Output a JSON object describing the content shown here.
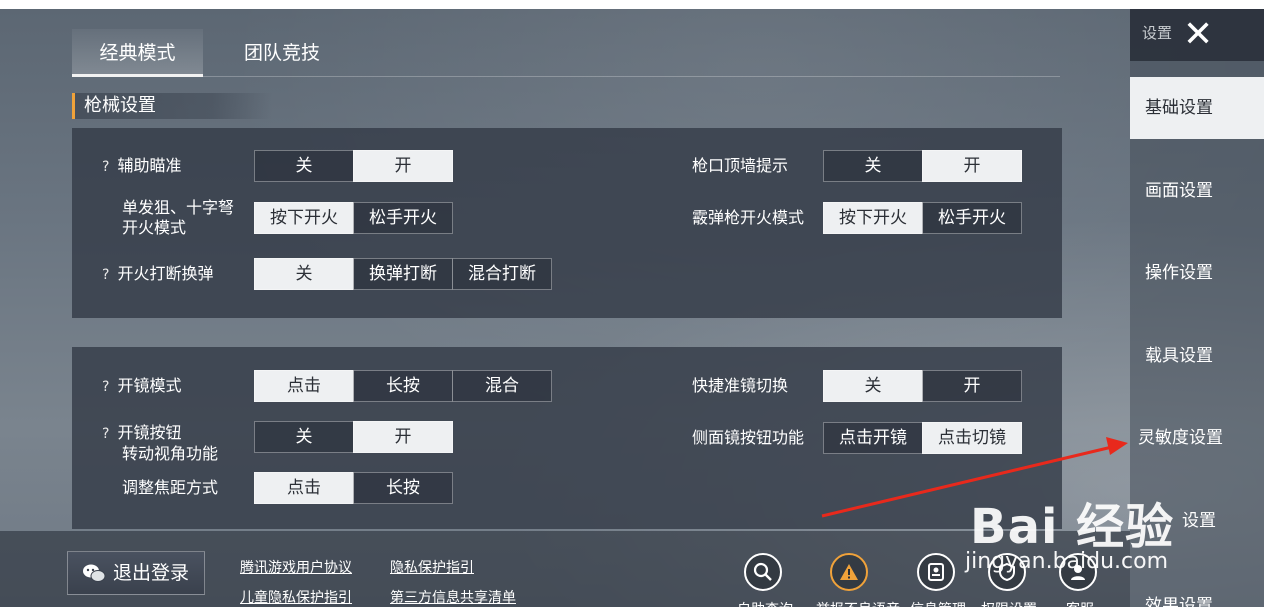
{
  "tabs": [
    {
      "label": "经典模式",
      "active": true
    },
    {
      "label": "团队竞技",
      "active": false
    }
  ],
  "section_title": "枪械设置",
  "panel1": {
    "assist_aim": {
      "label": "辅助瞄准",
      "options": [
        "关",
        "开"
      ],
      "selected": "开"
    },
    "single_fire": {
      "label_line1": "单发狙、十字弩",
      "label_line2": "开火模式",
      "options": [
        "按下开火",
        "松手开火"
      ],
      "selected": "按下开火"
    },
    "fire_interrupt": {
      "label": "开火打断换弹",
      "options": [
        "关",
        "换弹打断",
        "混合打断"
      ],
      "selected": "关"
    },
    "muzzle_wall": {
      "label": "枪口顶墙提示",
      "options": [
        "关",
        "开"
      ],
      "selected": "开"
    },
    "shotgun_fire": {
      "label": "霰弹枪开火模式",
      "options": [
        "按下开火",
        "松手开火"
      ],
      "selected": "按下开火"
    }
  },
  "panel2": {
    "scope_mode": {
      "label": "开镜模式",
      "options": [
        "点击",
        "长按",
        "混合"
      ],
      "selected": "点击"
    },
    "scope_button": {
      "label_line1": "开镜按钮",
      "label_line2": "转动视角功能",
      "options": [
        "关",
        "开"
      ],
      "selected": "开"
    },
    "focus_mode": {
      "label": "调整焦距方式",
      "options": [
        "点击",
        "长按"
      ],
      "selected": "点击"
    },
    "quick_scope": {
      "label": "快捷准镜切换",
      "options": [
        "关",
        "开"
      ],
      "selected": "关"
    },
    "side_scope": {
      "label": "侧面镜按钮功能",
      "options": [
        "点击开镜",
        "点击切镜"
      ],
      "selected": "点击切镜"
    }
  },
  "question_mark": "?",
  "sidebar": {
    "title": "设置",
    "close_glyph": "✕",
    "items": [
      {
        "label": "基础设置",
        "active": true
      },
      {
        "label": "画面设置",
        "active": false
      },
      {
        "label": "操作设置",
        "active": false
      },
      {
        "label": "载具设置",
        "active": false
      },
      {
        "label": "灵敏度设置",
        "active": false
      },
      {
        "label": "设置",
        "active": false
      },
      {
        "label": "效果设置",
        "active": false
      }
    ]
  },
  "bottom": {
    "logout": "退出登录",
    "links": [
      "腾讯游戏用户协议",
      "隐私保护指引",
      "儿童隐私保护指引",
      "第三方信息共享清单"
    ],
    "icon_buttons": [
      {
        "label": "自助查询",
        "icon": "search-icon"
      },
      {
        "label": "举报不良语音",
        "icon": "warning-icon"
      },
      {
        "label": "信息管理",
        "icon": "id-card-icon"
      },
      {
        "label": "权限设置",
        "icon": "shield-icon"
      },
      {
        "label": "客服",
        "icon": "person-icon"
      }
    ]
  },
  "watermark": {
    "logo": "Bai 经验",
    "url": "jingyan.baidu.com"
  },
  "colors": {
    "accent": "#f0a23a",
    "selected_bg": "#eef0f2",
    "annotation_arrow": "#e8291c"
  }
}
